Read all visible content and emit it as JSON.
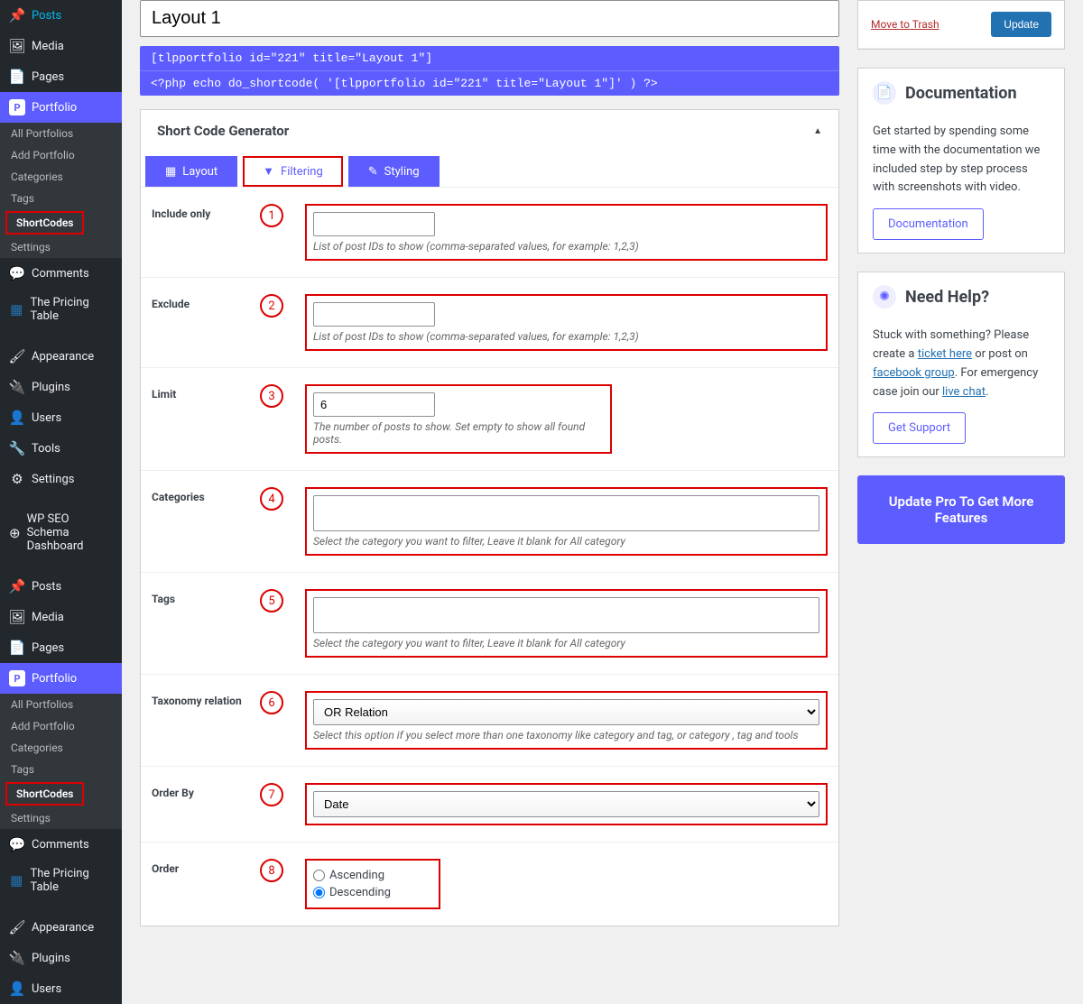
{
  "sidebar": {
    "items1": [
      {
        "icon": "📌",
        "label": "Posts"
      },
      {
        "icon": "🖼",
        "label": "Media"
      },
      {
        "icon": "📄",
        "label": "Pages"
      }
    ],
    "portfolio": {
      "icon": "P",
      "label": "Portfolio"
    },
    "sub1": [
      "All Portfolios",
      "Add Portfolio",
      "Categories",
      "Tags",
      "ShortCodes",
      "Settings"
    ],
    "items2": [
      {
        "icon": "💬",
        "label": "Comments"
      },
      {
        "icon": "▦",
        "label": "The Pricing Table"
      }
    ],
    "items3": [
      {
        "icon": "🖌",
        "label": "Appearance"
      },
      {
        "icon": "🔌",
        "label": "Plugins"
      },
      {
        "icon": "👤",
        "label": "Users"
      },
      {
        "icon": "🔧",
        "label": "Tools"
      },
      {
        "icon": "⚙",
        "label": "Settings"
      }
    ],
    "seo": {
      "icon": "⊕",
      "label": "WP SEO Schema Dashboard"
    },
    "items4": [
      {
        "icon": "📌",
        "label": "Posts"
      },
      {
        "icon": "🖼",
        "label": "Media"
      },
      {
        "icon": "📄",
        "label": "Pages"
      }
    ],
    "items5": [
      {
        "icon": "💬",
        "label": "Comments"
      },
      {
        "icon": "▦",
        "label": "The Pricing Table"
      }
    ],
    "items6": [
      {
        "icon": "🖌",
        "label": "Appearance"
      },
      {
        "icon": "🔌",
        "label": "Plugins"
      },
      {
        "icon": "👤",
        "label": "Users"
      }
    ]
  },
  "title_input": "Layout 1",
  "code": {
    "line1": "[tlpportfolio id=\"221\" title=\"Layout 1\"]",
    "line2": "<?php echo do_shortcode( '[tlpportfolio id=\"221\" title=\"Layout 1\"]' ) ?>"
  },
  "panel_title": "Short Code Generator",
  "tabs": {
    "layout": "Layout",
    "filtering": "Filtering",
    "styling": "Styling"
  },
  "fields": {
    "include": {
      "label": "Include only",
      "value": "",
      "hint": "List of post IDs to show (comma-separated values, for example: 1,2,3)",
      "num": "1"
    },
    "exclude": {
      "label": "Exclude",
      "value": "",
      "hint": "List of post IDs to show (comma-separated values, for example: 1,2,3)",
      "num": "2"
    },
    "limit": {
      "label": "Limit",
      "value": "6",
      "hint": "The number of posts to show. Set empty to show all found posts.",
      "num": "3"
    },
    "categories": {
      "label": "Categories",
      "hint": "Select the category you want to filter, Leave it blank for All category",
      "num": "4"
    },
    "tags": {
      "label": "Tags",
      "hint": "Select the category you want to filter, Leave it blank for All category",
      "num": "5"
    },
    "taxonomy": {
      "label": "Taxonomy relation",
      "value": "OR Relation",
      "hint": "Select this option if you select more than one taxonomy like category and tag, or category , tag and tools",
      "num": "6"
    },
    "orderby": {
      "label": "Order By",
      "value": "Date",
      "num": "7"
    },
    "order": {
      "label": "Order",
      "asc": "Ascending",
      "desc": "Descending",
      "num": "8"
    }
  },
  "aside": {
    "trash": "Move to Trash",
    "update": "Update",
    "doc": {
      "title": "Documentation",
      "text": "Get started by spending some time with the documentation we included step by step process with screenshots with video.",
      "btn": "Documentation"
    },
    "help": {
      "title": "Need Help?",
      "text1": "Stuck with something? Please create a ",
      "ticket": "ticket here",
      "text2": " or post on ",
      "fb": "facebook group",
      "text3": ". For emergency case join our ",
      "chat": "live chat",
      "text4": ".",
      "btn": "Get Support"
    },
    "cta": "Update Pro To Get More Features"
  }
}
